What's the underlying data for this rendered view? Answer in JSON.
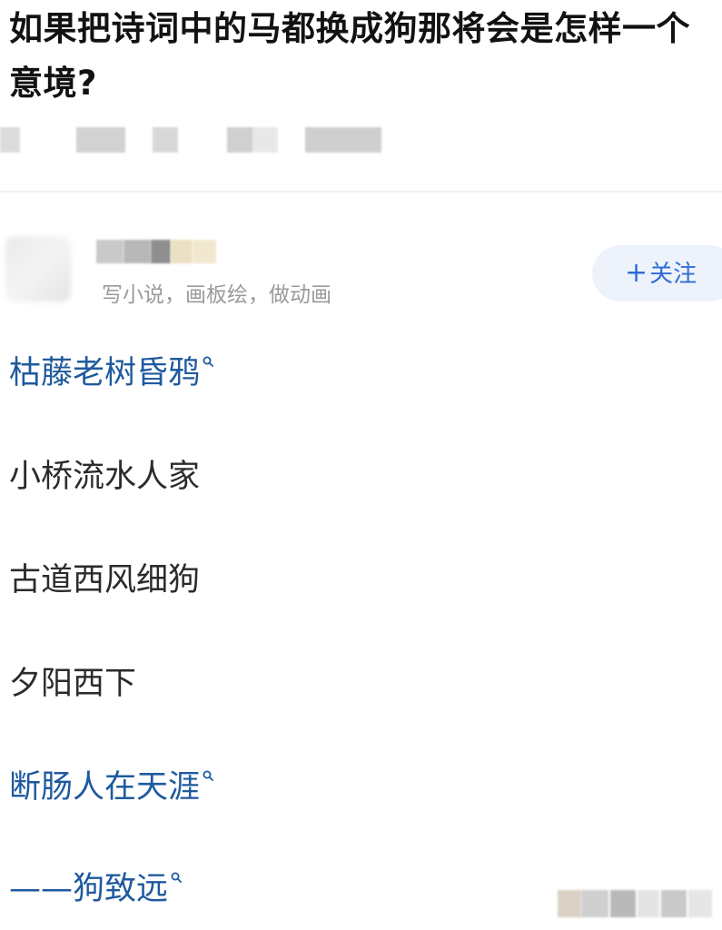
{
  "question": {
    "title": "如果把诗词中的马都换成狗那将会是怎样一个意境?"
  },
  "author": {
    "bio": "写小说，画板绘，做动画",
    "follow_label": "关注"
  },
  "answer": {
    "lines": [
      {
        "text": "枯藤老树昏鸦",
        "link": true
      },
      {
        "text": "小桥流水人家",
        "link": false
      },
      {
        "text": "古道西风细狗",
        "link": false
      },
      {
        "text": "夕阳西下",
        "link": false
      },
      {
        "text": "断肠人在天涯",
        "link": true
      },
      {
        "text": "——狗致远",
        "link": true
      }
    ]
  },
  "icons": {
    "search": "search-icon",
    "plus": "plus-icon"
  },
  "colors": {
    "link": "#1f5a9e",
    "follow_text": "#2f6dd6",
    "follow_bg": "#eef3fb",
    "secondary_text": "#9a9a9a"
  }
}
